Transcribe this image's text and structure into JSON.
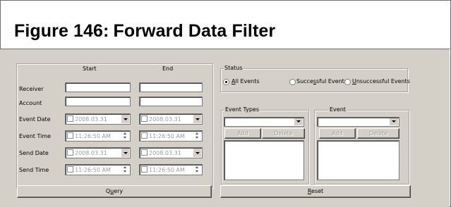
{
  "figure": {
    "label": "Figure 146:",
    "title": "Forward Data Filter"
  },
  "left_panel": {
    "col_start": "Start",
    "col_end": "End",
    "rows": [
      {
        "label": "Receiver",
        "start": "",
        "end": ""
      },
      {
        "label": "Account",
        "start": "",
        "end": ""
      }
    ],
    "event_date": {
      "label": "Event Date",
      "start": "2008.03.31",
      "end": "2008.03.31"
    },
    "event_time": {
      "label": "Event Time",
      "start": "11:26:50 AM",
      "end": "11:26:50 AM"
    },
    "send_date": {
      "label": "Send Date",
      "start": "2008.03.31",
      "end": "2008.03.31"
    },
    "send_time": {
      "label": "Send Time",
      "start": "11:26:50 AM",
      "end": "11:26:50 AM"
    }
  },
  "status": {
    "group_label": "Status",
    "options": [
      "All Events",
      "Successful Events",
      "Unsuccessful Events"
    ],
    "selected": "All Events"
  },
  "event_types": {
    "group_label": "Event Types",
    "selected_value": "",
    "add_label": "Add",
    "delete_label": "Delete"
  },
  "event": {
    "group_label": "Event",
    "selected_value": "",
    "add_label": "Add",
    "delete_label": "Delete"
  },
  "buttons": {
    "query": "Query",
    "reset": "Reset"
  },
  "colors": {
    "dialog_bg": "#d4d0c8",
    "disabled_text": "#9b9b9b"
  }
}
